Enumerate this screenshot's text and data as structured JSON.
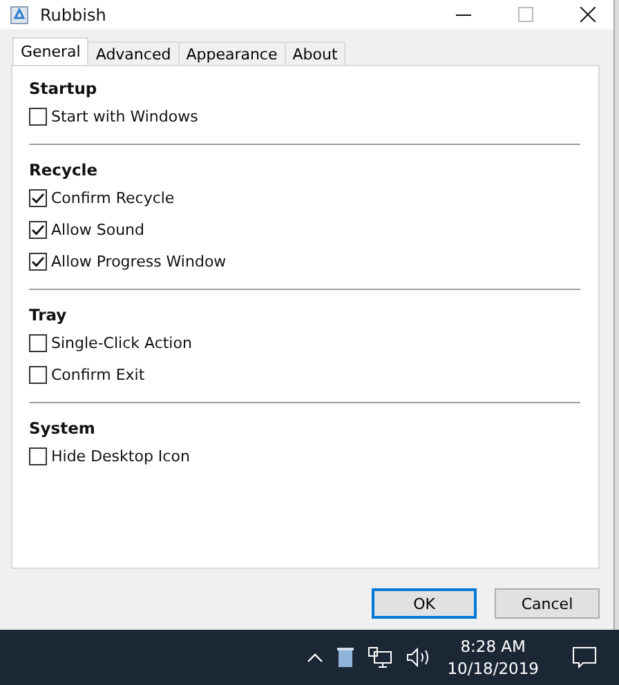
{
  "window": {
    "title": "Rubbish"
  },
  "tabs": [
    {
      "label": "General",
      "selected": true
    },
    {
      "label": "Advanced",
      "selected": false
    },
    {
      "label": "Appearance",
      "selected": false
    },
    {
      "label": "About",
      "selected": false
    }
  ],
  "sections": [
    {
      "title": "Startup",
      "options": [
        {
          "label": "Start with Windows",
          "checked": false
        }
      ]
    },
    {
      "title": "Recycle",
      "options": [
        {
          "label": "Confirm Recycle",
          "checked": true
        },
        {
          "label": "Allow Sound",
          "checked": true
        },
        {
          "label": "Allow Progress Window",
          "checked": true
        }
      ]
    },
    {
      "title": "Tray",
      "options": [
        {
          "label": "Single-Click Action",
          "checked": false
        },
        {
          "label": "Confirm Exit",
          "checked": false
        }
      ]
    },
    {
      "title": "System",
      "options": [
        {
          "label": "Hide Desktop Icon",
          "checked": false
        }
      ]
    }
  ],
  "buttons": [
    {
      "label": "OK",
      "default": true
    },
    {
      "label": "Cancel",
      "default": false
    }
  ],
  "taskbar": {
    "time": "8:28 AM",
    "date": "10/18/2019"
  }
}
